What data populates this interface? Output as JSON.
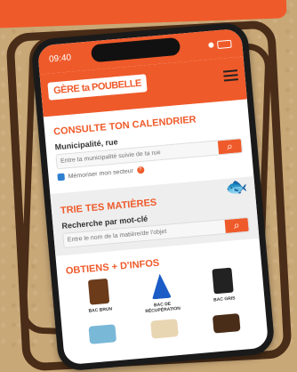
{
  "status": {
    "time": "09:40"
  },
  "app": {
    "logo": "GÈRE ta POUBELLE"
  },
  "calendar": {
    "title": "CONSULTE TON CALENDRIER",
    "field_label": "Municipalité, rue",
    "placeholder": "Entre ta municipalité suivie de ta rue",
    "remember_label": "Mémoriser mon secteur"
  },
  "sort": {
    "title": "TRIE TES MATIÈRES",
    "field_label": "Recherche par mot-clé",
    "placeholder": "Entre le nom de la matière/de l'objet"
  },
  "info": {
    "title": "OBTIENS + D'INFOS",
    "cards": [
      {
        "label": "BAC BRUN"
      },
      {
        "label": "BAC DE RÉCUPÉRATION"
      },
      {
        "label": "BAC GRIS"
      }
    ]
  },
  "colors": {
    "accent": "#ef5a2a",
    "frame": "#4a2d18"
  }
}
